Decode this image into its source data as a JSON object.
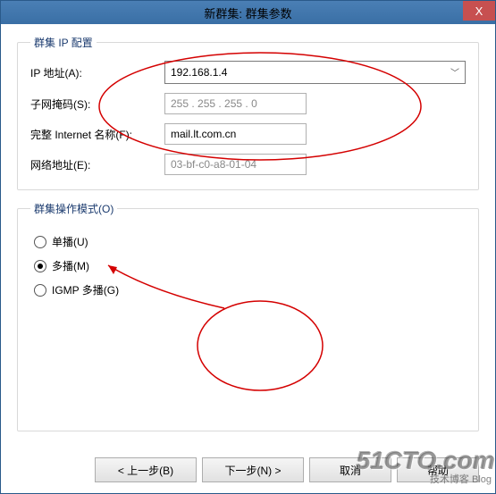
{
  "title": "新群集: 群集参数",
  "close_symbol": "X",
  "ipconfig": {
    "legend": "群集 IP 配置",
    "ip_label": "IP 地址(A):",
    "ip_value": "192.168.1.4",
    "subnet_label": "子网掩码(S):",
    "subnet_value": "255 . 255 . 255 .   0",
    "fqdn_label": "完整 Internet 名称(F):",
    "fqdn_value": "mail.lt.com.cn",
    "netaddr_label": "网络地址(E):",
    "netaddr_value": "03-bf-c0-a8-01-04"
  },
  "mode": {
    "legend": "群集操作模式(O)",
    "opts": [
      {
        "label": "单播(U)",
        "selected": false
      },
      {
        "label": "多播(M)",
        "selected": true
      },
      {
        "label": "IGMP 多播(G)",
        "selected": false
      }
    ]
  },
  "buttons": {
    "back": "< 上一步(B)",
    "next": "下一步(N) >",
    "cancel": "取消",
    "help": "帮助"
  },
  "watermark": "51CTO.com",
  "watermark_sub": "技术博客    Blog"
}
